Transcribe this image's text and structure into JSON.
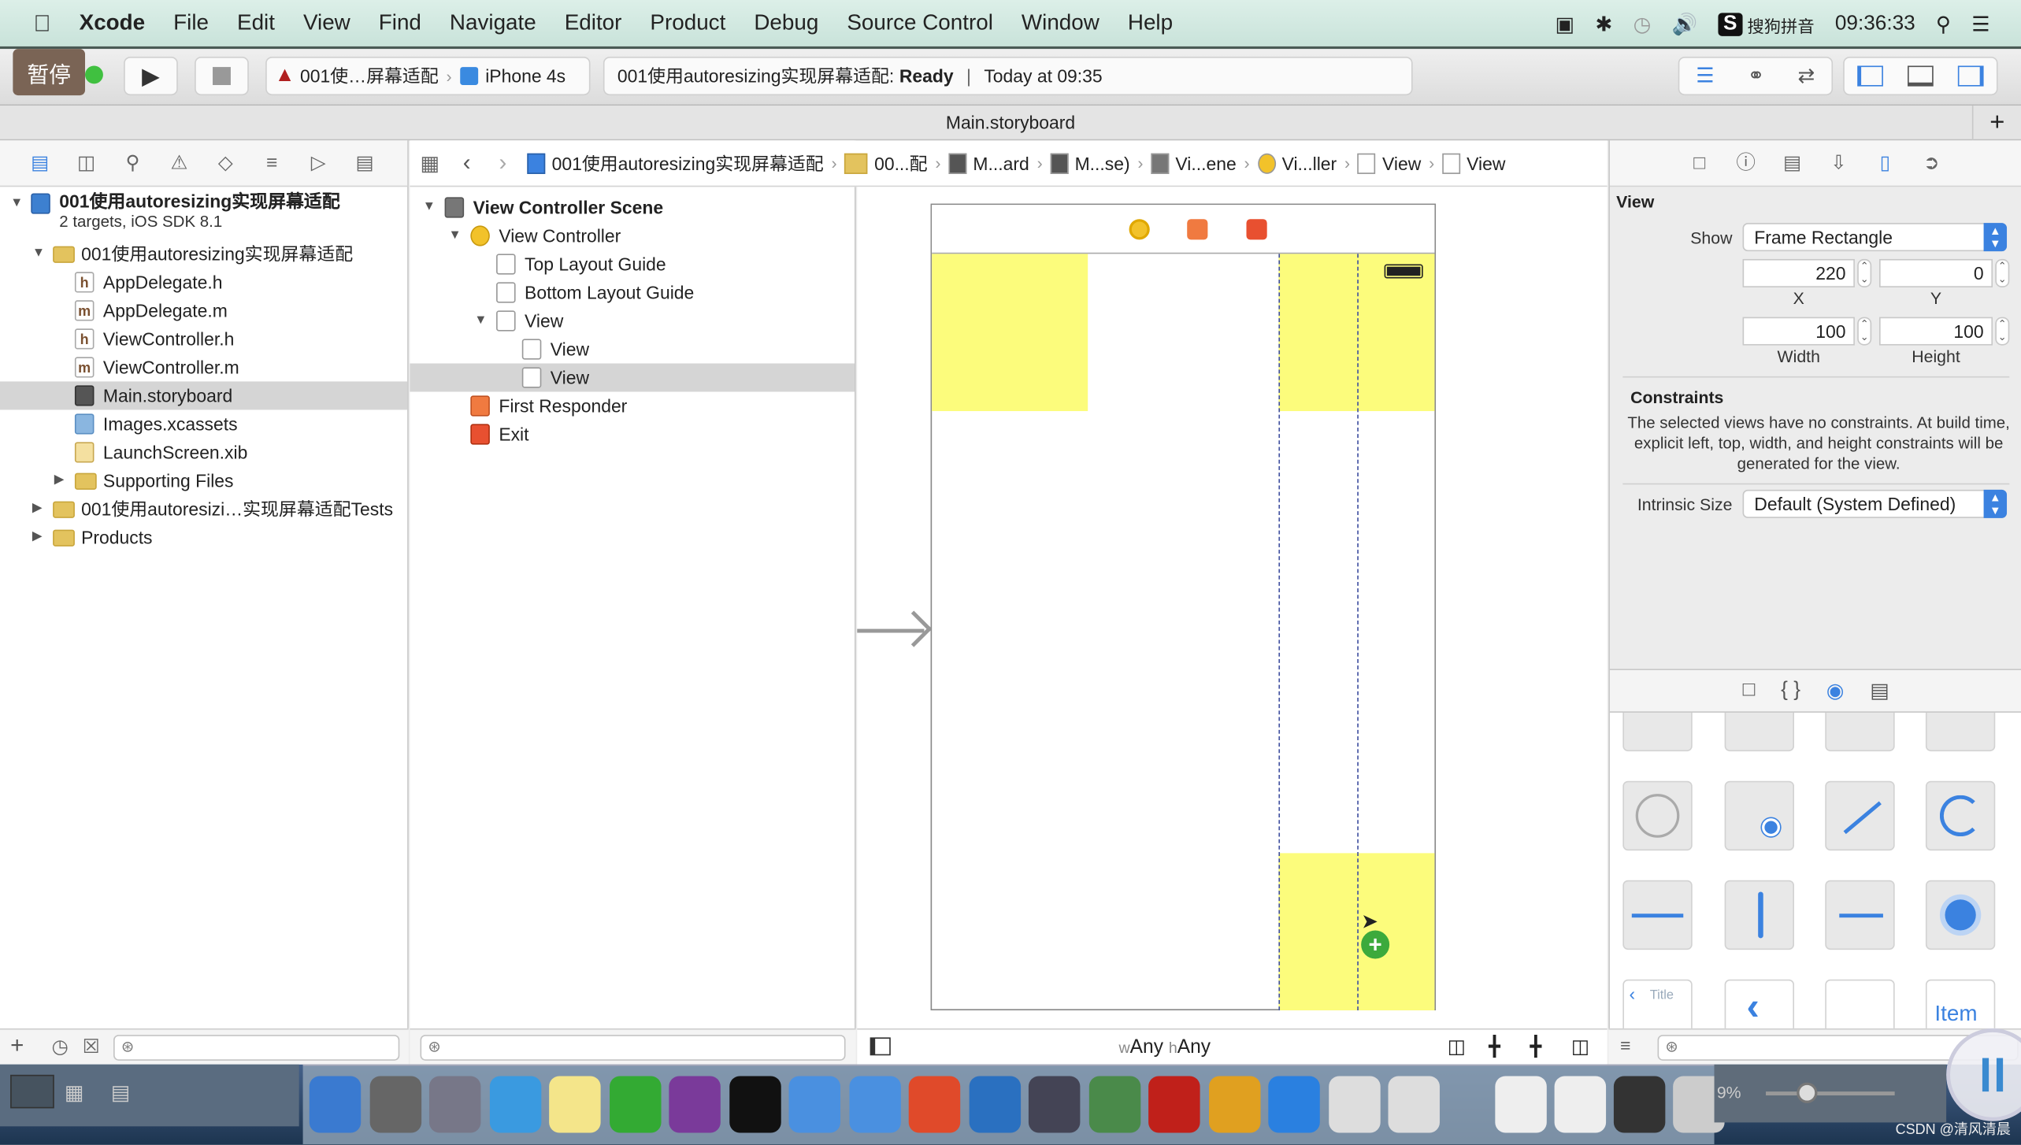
{
  "menubar": {
    "app": "Xcode",
    "items": [
      "File",
      "Edit",
      "View",
      "Find",
      "Navigate",
      "Editor",
      "Product",
      "Debug",
      "Source Control",
      "Window",
      "Help"
    ],
    "input_method": "搜狗拼音",
    "clock": "09:36:33",
    "status_icons": [
      "screen-record-icon",
      "bluetooth-icon",
      "time-machine-icon",
      "volume-icon",
      "sogou-icon",
      "search-icon",
      "list-icon"
    ]
  },
  "toolbar": {
    "pause_label": "暂停",
    "scheme": "001使…屏幕适配",
    "device": "iPhone 4s",
    "status_project": "001使用autoresizing实现屏幕适配:",
    "status_state": "Ready",
    "status_time": "Today at 09:35"
  },
  "tab": {
    "title": "Main.storyboard"
  },
  "jumpbar": [
    "001使用autoresizing实现屏幕适配",
    "00...配",
    "M...ard",
    "M...se)",
    "Vi...ene",
    "Vi...ller",
    "View",
    "View"
  ],
  "navigator": {
    "tree": [
      {
        "label": "001使用autoresizing实现屏幕适配",
        "subtitle": "2 targets, iOS SDK 8.1",
        "icon": "proj",
        "expanded": true,
        "bold": true,
        "children": [
          {
            "label": "001使用autoresizing实现屏幕适配",
            "icon": "folder",
            "expanded": true,
            "children": [
              {
                "label": "AppDelegate.h",
                "icon": "h",
                "glyph": "h"
              },
              {
                "label": "AppDelegate.m",
                "icon": "m",
                "glyph": "m"
              },
              {
                "label": "ViewController.h",
                "icon": "h",
                "glyph": "h"
              },
              {
                "label": "ViewController.m",
                "icon": "m",
                "glyph": "m"
              },
              {
                "label": "Main.storyboard",
                "icon": "sb",
                "selected": true
              },
              {
                "label": "Images.xcassets",
                "icon": "xc"
              },
              {
                "label": "LaunchScreen.xib",
                "icon": "xib"
              },
              {
                "label": "Supporting Files",
                "icon": "folder",
                "expanded": false,
                "children": []
              }
            ]
          },
          {
            "label": "001使用autoresizi…实现屏幕适配Tests",
            "icon": "folder",
            "expanded": false,
            "children": []
          },
          {
            "label": "Products",
            "icon": "folder",
            "expanded": false,
            "children": []
          }
        ]
      }
    ]
  },
  "outline": {
    "tree": [
      {
        "label": "View Controller Scene",
        "icon": "scene",
        "expanded": true,
        "bold": true,
        "children": [
          {
            "label": "View Controller",
            "icon": "vc",
            "expanded": true,
            "children": [
              {
                "label": "Top Layout Guide",
                "icon": "view"
              },
              {
                "label": "Bottom Layout Guide",
                "icon": "view"
              },
              {
                "label": "View",
                "icon": "view",
                "expanded": true,
                "children": [
                  {
                    "label": "View",
                    "icon": "view"
                  },
                  {
                    "label": "View",
                    "icon": "view",
                    "selected": true
                  }
                ]
              }
            ]
          },
          {
            "label": "First Responder",
            "icon": "fr"
          },
          {
            "label": "Exit",
            "icon": "exit"
          }
        ]
      }
    ]
  },
  "canvas": {
    "size_class": {
      "w": "w",
      "w_val": "Any",
      "h": "h",
      "h_val": "Any"
    },
    "yellow": "#fcfc7c"
  },
  "inspector": {
    "section": "View",
    "show_label": "Show",
    "show_value": "Frame Rectangle",
    "x": "220",
    "x_label": "X",
    "y": "0",
    "y_label": "Y",
    "width": "100",
    "width_label": "Width",
    "height": "100",
    "height_label": "Height",
    "constraints_title": "Constraints",
    "constraints_text": "The selected views have no constraints. At build time, explicit left, top, width, and height constraints will be generated for the view.",
    "intrinsic_label": "Intrinsic Size",
    "intrinsic_value": "Default (System Defined)"
  },
  "library": {
    "title_label": "Title",
    "item_label": "Item"
  },
  "dock": {
    "zoom_text": "9%"
  },
  "watermark": "CSDN @清风清晨",
  "colors": {
    "accent": "#3b82e0",
    "selection": "#d5d5d5",
    "canvas_yellow": "#fcfc7c"
  }
}
